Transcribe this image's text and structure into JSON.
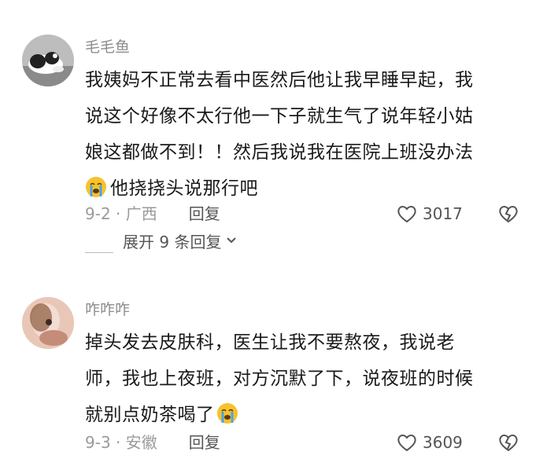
{
  "comments": [
    {
      "username": "毛毛鱼",
      "lines": [
        "我姨妈不正常去看中医然后他让我早睡早起，我",
        "说这个好像不太行他一下子就生气了说年轻小姑",
        "娘这都做不到！！然后我说我在医院上班没办法",
        "他挠挠头说那行吧"
      ],
      "date_location": "9-2 · 广西",
      "reply_label": "回复",
      "likes": "3017",
      "expand_label": "展开 9 条回复",
      "avatar_icon": "cat-avatar",
      "emoji_icon": "crying-face-icon"
    },
    {
      "username": "咋咋咋",
      "lines": [
        "掉头发去皮肤科，医生让我不要熬夜，我说老",
        "师，我也上夜班，对方沉默了下，说夜班的时候",
        "就别点奶茶喝了"
      ],
      "date_location": "9-3 · 安徽",
      "reply_label": "回复",
      "likes": "3609",
      "avatar_icon": "person-avatar",
      "emoji_icon": "crying-face-icon"
    }
  ],
  "colors": {
    "username": "#8d8d8d",
    "meta": "#9a9a9a",
    "text": "#1a1a1a",
    "emoji": "#f7c22b"
  }
}
